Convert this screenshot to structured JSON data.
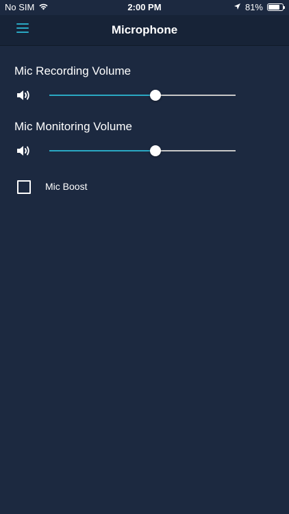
{
  "status_bar": {
    "carrier": "No SIM",
    "time": "2:00 PM",
    "battery_percent": "81%",
    "battery_level": 0.81,
    "icons": [
      "wifi-icon",
      "location-arrow-icon",
      "battery-icon"
    ]
  },
  "nav": {
    "title": "Microphone",
    "menu_icon": "hamburger-menu-icon"
  },
  "recording": {
    "label": "Mic Recording Volume",
    "value": 0.57
  },
  "monitoring": {
    "label": "Mic Monitoring Volume",
    "value": 0.57
  },
  "mic_boost": {
    "label": "Mic Boost",
    "checked": false
  },
  "colors": {
    "background": "#1c2940",
    "navbar": "#172337",
    "accent": "#2aa9c4"
  }
}
